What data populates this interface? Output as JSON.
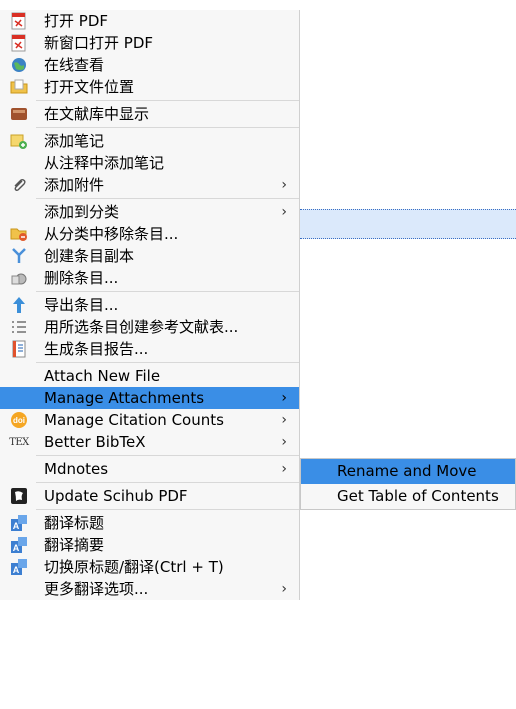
{
  "menu": {
    "items": [
      {
        "label": "打开 PDF",
        "icon": "pdf-icon",
        "arrow": ""
      },
      {
        "label": "新窗口打开 PDF",
        "icon": "pdf-icon",
        "arrow": ""
      },
      {
        "label": "在线查看",
        "icon": "globe-icon",
        "arrow": ""
      },
      {
        "label": "打开文件位置",
        "icon": "folder-icon",
        "arrow": ""
      },
      {
        "label": "在文献库中显示",
        "icon": "library-icon",
        "arrow": ""
      },
      {
        "label": "添加笔记",
        "icon": "add-note-icon",
        "arrow": ""
      },
      {
        "label": "从注释中添加笔记",
        "icon": "",
        "arrow": ""
      },
      {
        "label": "添加附件",
        "icon": "paperclip-icon",
        "arrow": "›"
      },
      {
        "label": "添加到分类",
        "icon": "",
        "arrow": "›"
      },
      {
        "label": "从分类中移除条目...",
        "icon": "remove-folder-icon",
        "arrow": ""
      },
      {
        "label": "创建条目副本",
        "icon": "duplicate-icon",
        "arrow": ""
      },
      {
        "label": "删除条目...",
        "icon": "trash-icon",
        "arrow": ""
      },
      {
        "label": "导出条目...",
        "icon": "export-icon",
        "arrow": ""
      },
      {
        "label": "用所选条目创建参考文献表...",
        "icon": "bibliography-icon",
        "arrow": ""
      },
      {
        "label": "生成条目报告...",
        "icon": "report-icon",
        "arrow": ""
      },
      {
        "label": "Attach New File",
        "icon": "",
        "arrow": ""
      },
      {
        "label": "Manage Attachments",
        "icon": "",
        "arrow": "›"
      },
      {
        "label": "Manage Citation Counts",
        "icon": "doi-icon",
        "arrow": "›"
      },
      {
        "label": "Better BibTeX",
        "icon": "tex-icon",
        "arrow": "›"
      },
      {
        "label": "Mdnotes",
        "icon": "",
        "arrow": "›"
      },
      {
        "label": "Update Scihub PDF",
        "icon": "scihub-icon",
        "arrow": ""
      },
      {
        "label": "翻译标题",
        "icon": "translate-icon",
        "arrow": ""
      },
      {
        "label": "翻译摘要",
        "icon": "translate-icon",
        "arrow": ""
      },
      {
        "label": "切换原标题/翻译(Ctrl + T)",
        "icon": "translate-icon",
        "arrow": ""
      },
      {
        "label": "更多翻译选项...",
        "icon": "",
        "arrow": "›"
      }
    ],
    "tex_logo": "TEX"
  },
  "submenu": {
    "items": [
      {
        "label": "Rename and Move"
      },
      {
        "label": "Get Table of Contents"
      }
    ]
  },
  "colors": {
    "highlight": "#3a8ee6",
    "menu_bg": "#f7f7f7"
  }
}
